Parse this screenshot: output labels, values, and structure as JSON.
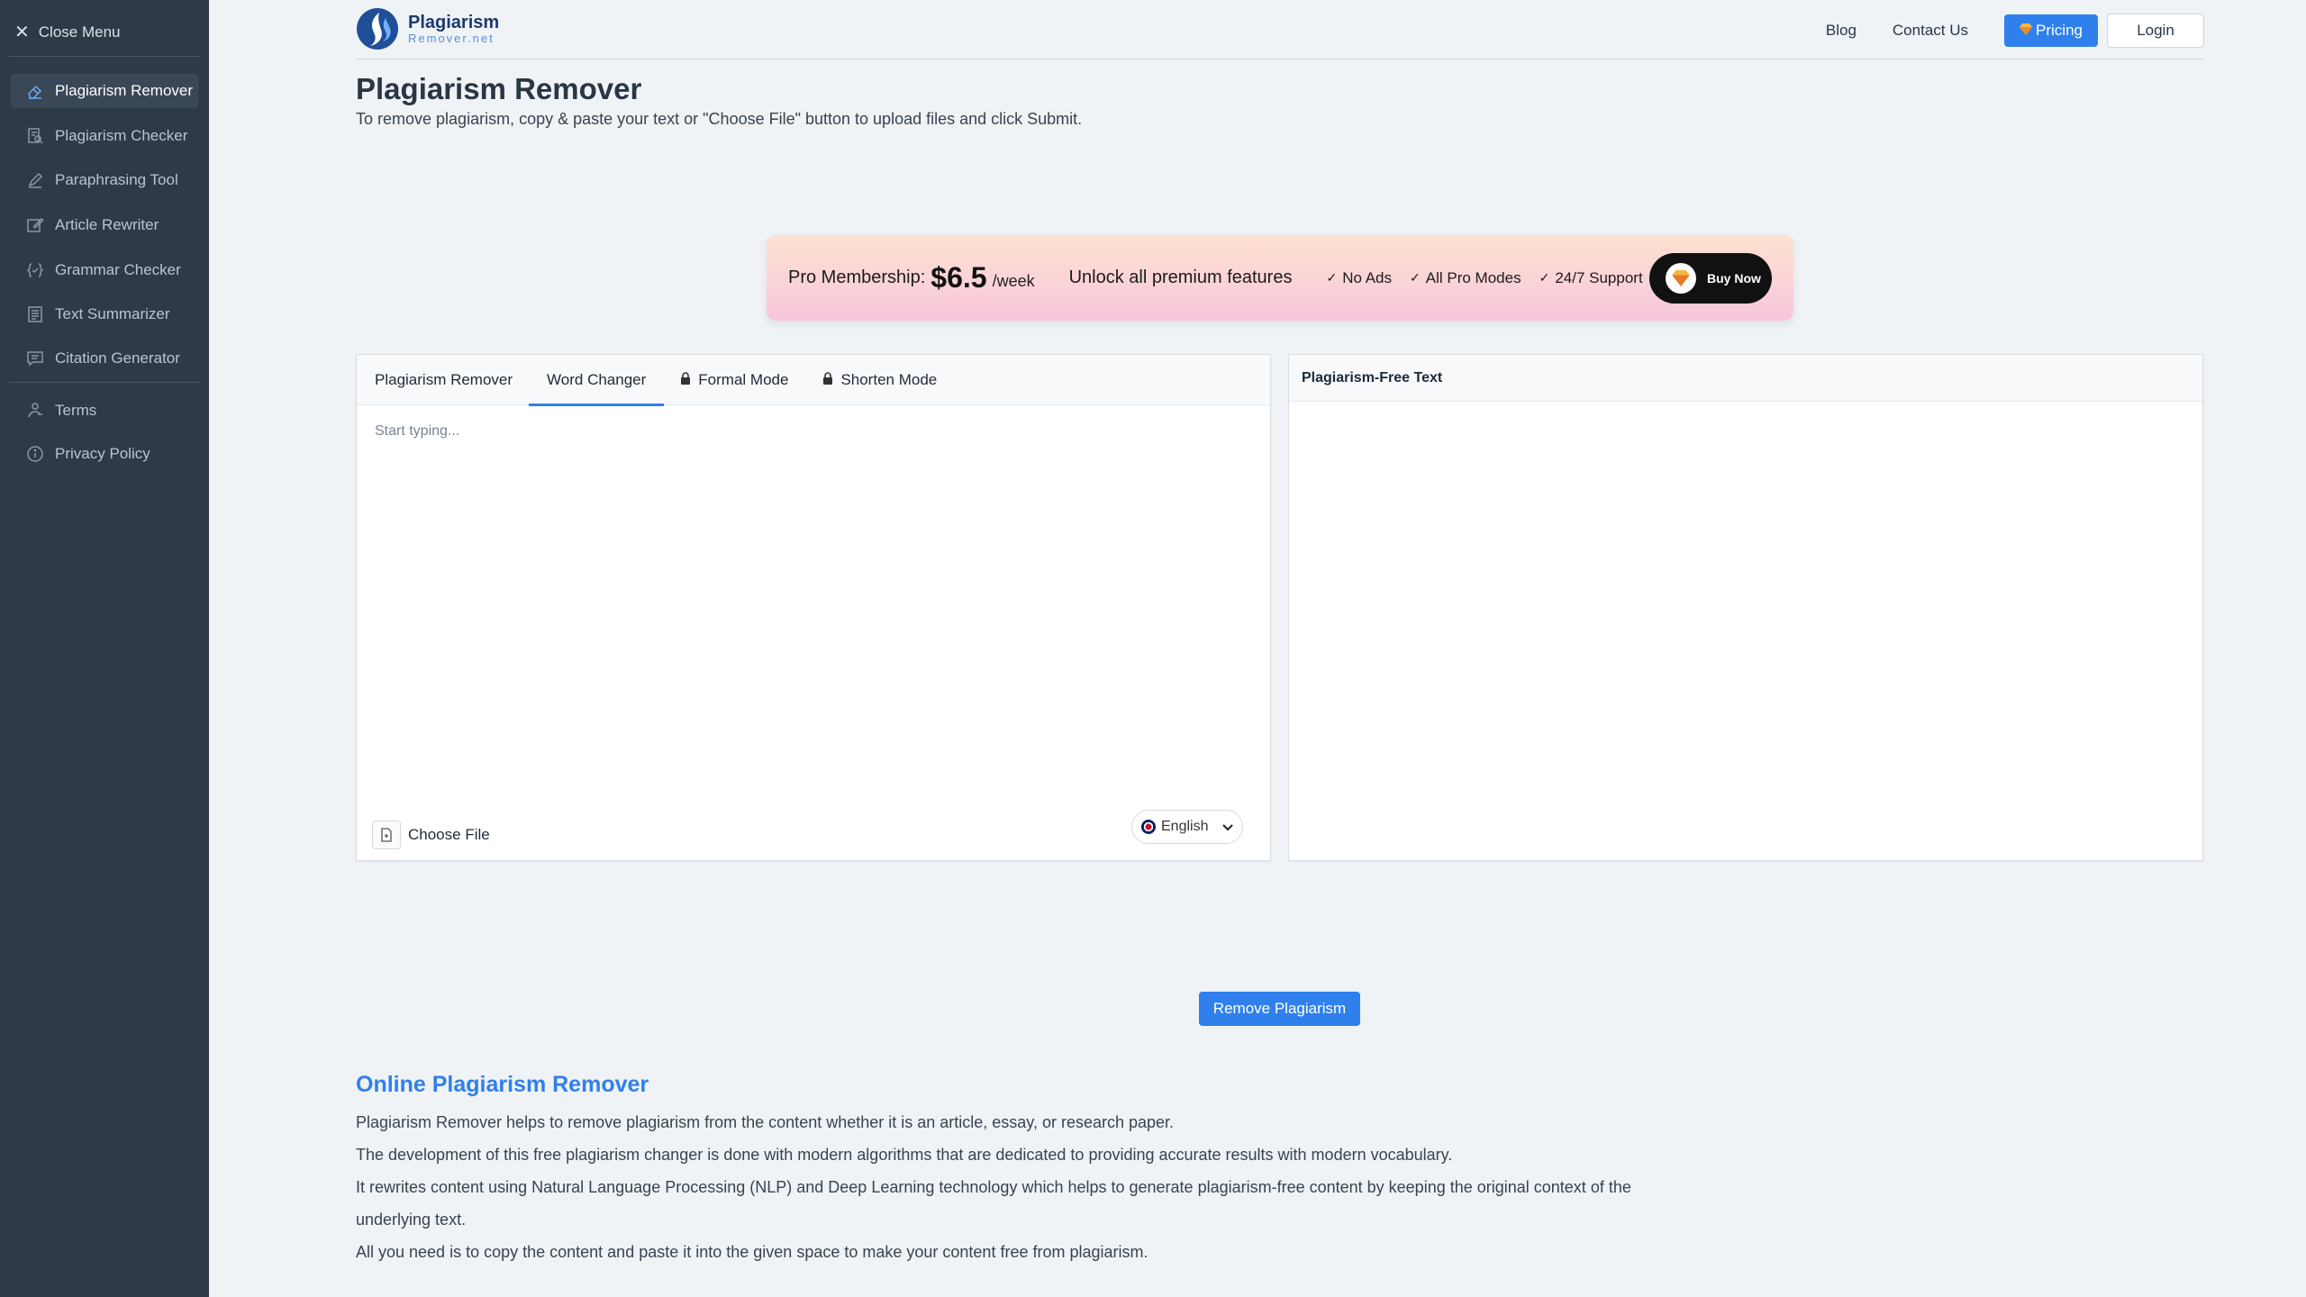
{
  "sidebar": {
    "close_label": "Close Menu",
    "items": [
      {
        "label": "Plagiarism Remover",
        "icon": "eraser-icon"
      },
      {
        "label": "Plagiarism Checker",
        "icon": "search-document-icon"
      },
      {
        "label": "Paraphrasing Tool",
        "icon": "pen-icon"
      },
      {
        "label": "Article Rewriter",
        "icon": "edit-icon"
      },
      {
        "label": "Grammar Checker",
        "icon": "braces-check-icon"
      },
      {
        "label": "Text Summarizer",
        "icon": "list-document-icon"
      },
      {
        "label": "Citation Generator",
        "icon": "quote-bubble-icon"
      }
    ],
    "footer_items": [
      {
        "label": "Terms",
        "icon": "hand-icon"
      },
      {
        "label": "Privacy Policy",
        "icon": "info-icon"
      }
    ]
  },
  "header": {
    "logo_line1": "Plagiarism",
    "logo_line2": "Remover.net",
    "nav": {
      "blog": "Blog",
      "contact": "Contact Us",
      "pricing": "Pricing",
      "login": "Login"
    }
  },
  "page": {
    "title": "Plagiarism Remover",
    "subtitle": "To remove plagiarism, copy & paste your text or \"Choose File\" button to upload files and click Submit."
  },
  "promo": {
    "label": "Pro Membership:",
    "price": "$6.5",
    "period": "/week",
    "unlock": "Unlock all premium features",
    "features": [
      "No Ads",
      "All Pro Modes",
      "24/7 Support"
    ],
    "buy": "Buy Now"
  },
  "editor": {
    "tabs": [
      "Plagiarism Remover",
      "Word Changer",
      "Formal Mode",
      "Shorten Mode"
    ],
    "active_tab": "Word Changer",
    "placeholder": "Start typing...",
    "choose_file": "Choose File",
    "language": "English",
    "output_title": "Plagiarism-Free Text"
  },
  "action": {
    "remove": "Remove Plagiarism"
  },
  "article": {
    "title": "Online Plagiarism Remover",
    "p1": "Plagiarism Remover helps to remove plagiarism from the content whether it is an article, essay, or research paper.",
    "p2": "The development of this free plagiarism changer is done with modern algorithms that are dedicated to providing accurate results with modern vocabulary.",
    "p3": "It rewrites content using Natural Language Processing (NLP) and Deep Learning technology which helps to generate plagiarism-free content by keeping the original context of the underlying text.",
    "p4": "All you need is to copy the content and paste it into the given space to make your content free from plagiarism."
  },
  "colors": {
    "sidebar": "#2e3a47",
    "accent": "#2f80ed",
    "background": "#eff3f6"
  }
}
